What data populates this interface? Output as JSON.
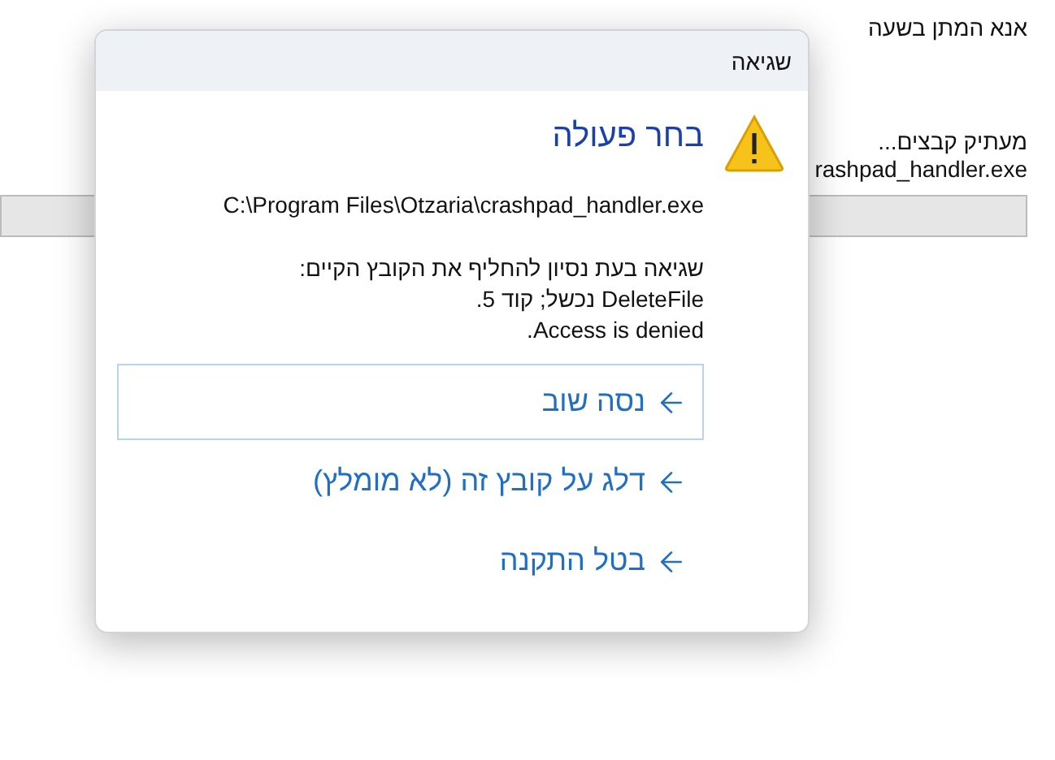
{
  "background": {
    "instruction": "אנא המתן בשעה",
    "status": "מעתיק קבצים...",
    "file": "rashpad_handler.exe"
  },
  "dialog": {
    "title": "שגיאה",
    "heading": "בחר פעולה",
    "path": "C:\\Program Files\\Otzaria\\crashpad_handler.exe",
    "message": [
      "שגיאה בעת נסיון להחליף את הקובץ הקיים:",
      "DeleteFile נכשל; קוד 5.",
      "Access is denied."
    ],
    "options": [
      {
        "label": "נסה שוב",
        "focused": true
      },
      {
        "label": "דלג על קובץ זה (לא מומלץ)",
        "focused": false
      },
      {
        "label": "בטל התקנה",
        "focused": false
      }
    ]
  }
}
